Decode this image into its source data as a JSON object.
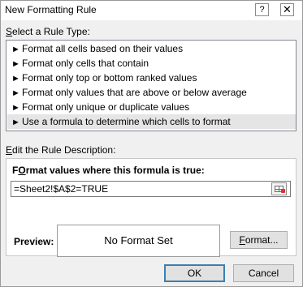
{
  "window": {
    "title": "New Formatting Rule",
    "help_label": "?",
    "close_label": "✕"
  },
  "rule_type": {
    "label_prefix_u": "S",
    "label_rest": "elect a Rule Type:",
    "items": [
      {
        "label": "Format all cells based on their values",
        "selected": false
      },
      {
        "label": "Format only cells that contain",
        "selected": false
      },
      {
        "label": "Format only top or bottom ranked values",
        "selected": false
      },
      {
        "label": "Format only values that are above or below average",
        "selected": false
      },
      {
        "label": "Format only unique or duplicate values",
        "selected": false
      },
      {
        "label": "Use a formula to determine which cells to format",
        "selected": true
      }
    ]
  },
  "description": {
    "label_prefix_u": "E",
    "label_rest": "dit the Rule Description:",
    "formula_label_u": "O",
    "formula_label_before": "F",
    "formula_label_after": "rmat values where this formula is true:",
    "formula_value": "=Sheet2!$A$2=TRUE",
    "preview_label": "Preview:",
    "preview_text": "No Format Set",
    "format_button_u": "F",
    "format_button_rest": "ormat..."
  },
  "buttons": {
    "ok": "OK",
    "cancel": "Cancel"
  },
  "colors": {
    "selected_row": "#e5e5e5",
    "default_button_border": "#3c7fb1"
  }
}
